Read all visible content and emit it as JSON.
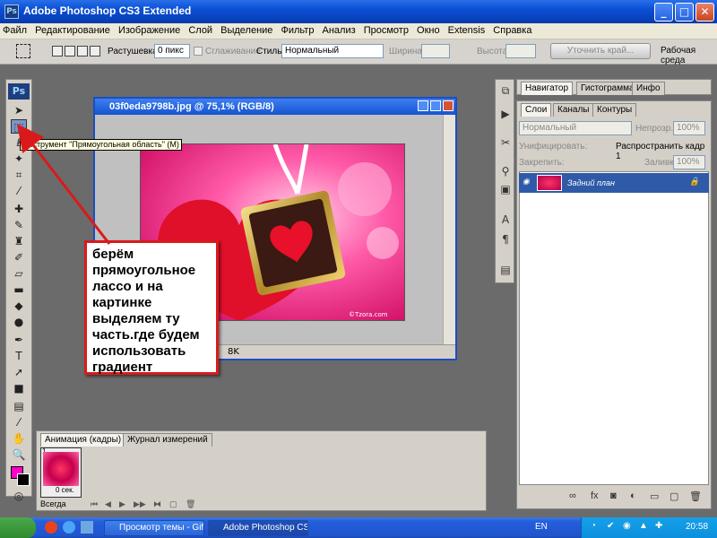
{
  "window": {
    "title": "Adobe Photoshop CS3 Extended",
    "ps_label": "Ps",
    "controls": {
      "minimize": "_",
      "maximize": "□",
      "close": "✕"
    }
  },
  "menu": [
    "Файл",
    "Редактирование",
    "Изображение",
    "Слой",
    "Выделение",
    "Фильтр",
    "Анализ",
    "Просмотр",
    "Окно",
    "Extensis",
    "Справка"
  ],
  "options": {
    "feather_label": "Растушевка:",
    "feather_value": "0 пикс",
    "antialias_label": "Сглаживание",
    "style_label": "Стиль:",
    "style_value": "Нормальный",
    "width_label": "Ширина:",
    "height_label": "Высота:",
    "refine_label": "Уточнить край...",
    "workspace_label": "Рабочая среда"
  },
  "toolbox": {
    "logo": "Ps",
    "tooltip": "Инструмент \"Прямоугольная область\" (M)"
  },
  "document": {
    "title": "03f0eda9798b.jpg @ 75,1% (RGB/8)",
    "status": "8K",
    "watermark": "©Tzora.com"
  },
  "callout": {
    "text": "берём прямоугольное лассо и на картинке выделяем ту часть.где будем использовать градиент"
  },
  "panels": {
    "top_tabs": [
      "Навигатор",
      "Гистограмма",
      "Инфо"
    ],
    "layer_tabs": [
      "Слои",
      "Каналы",
      "Контуры"
    ],
    "blend_mode": "Нормальный",
    "opacity_label": "Непрозр.:",
    "opacity_value": "100%",
    "unify_label": "Унифицировать:",
    "propagate_label": "Распространить кадр 1",
    "lock_label": "Закрепить:",
    "fill_label": "Заливка:",
    "fill_value": "100%",
    "layer_name": "Задний план"
  },
  "animation": {
    "tabs": [
      "Анимация (кадры)",
      "Журнал измерений"
    ],
    "frame_number": "1",
    "frame_delay": "0 сек.",
    "loop_value": "Всегда"
  },
  "taskbar": {
    "items": [
      "Просмотр темы - Gif ...",
      "Adobe Photoshop CS..."
    ],
    "lang": "EN",
    "clock": "20:58"
  },
  "colors": {
    "foreground": "#ff00c8",
    "background": "#000000",
    "callout_border": "#d91a1a",
    "xp_blue": "#0842bd"
  }
}
